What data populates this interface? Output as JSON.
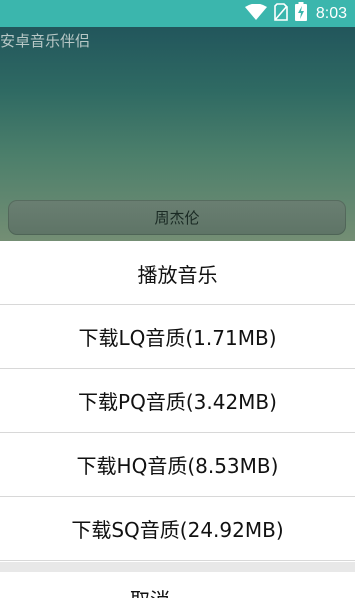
{
  "status_bar": {
    "time": "8:03",
    "icons": [
      "wifi-icon",
      "no-sim-icon",
      "battery-icon"
    ],
    "color": "#3bb6ad"
  },
  "app": {
    "title": "安卓音乐伴侣",
    "artist_button_label": "周杰伦"
  },
  "sheet": {
    "items": [
      {
        "label": "播放音乐"
      },
      {
        "label": "下载LQ音质(1.71MB)"
      },
      {
        "label": "下载PQ音质(3.42MB)"
      },
      {
        "label": "下载HQ音质(8.53MB)"
      },
      {
        "label": "下载SQ音质(24.92MB)"
      }
    ],
    "cancel_label": "取消"
  }
}
